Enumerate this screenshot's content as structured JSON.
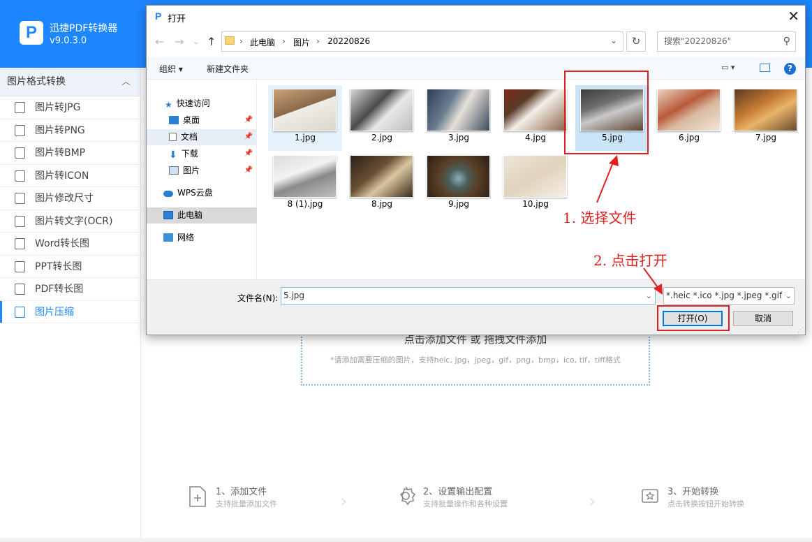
{
  "app": {
    "name": "迅捷PDF转换器",
    "version": "v9.0.3.0",
    "logo_letter": "P"
  },
  "sidebar": {
    "title": "图片格式转换",
    "items": [
      {
        "label": "图片转JPG",
        "active": false
      },
      {
        "label": "图片转PNG",
        "active": false
      },
      {
        "label": "图片转BMP",
        "active": false
      },
      {
        "label": "图片转ICON",
        "active": false
      },
      {
        "label": "图片修改尺寸",
        "active": false
      },
      {
        "label": "图片转文字(OCR)",
        "active": false
      },
      {
        "label": "Word转长图",
        "active": false
      },
      {
        "label": "PPT转长图",
        "active": false
      },
      {
        "label": "PDF转长图",
        "active": false
      },
      {
        "label": "图片压缩",
        "active": true
      }
    ]
  },
  "main": {
    "drop_text": "点击添加文件 或 拖拽文件添加",
    "drop_hint": "*请添加需要压缩的图片，支持heic, jpg，jpeg，gif，png，bmp，ico, tif，tiff格式",
    "steps": [
      {
        "title": "1、添加文件",
        "sub": "支持批量添加文件",
        "icon": "add-file-icon"
      },
      {
        "title": "2、设置输出配置",
        "sub": "支持批量操作和各种设置",
        "icon": "gear-icon"
      },
      {
        "title": "3、开始转换",
        "sub": "点击转换按钮开始转换",
        "icon": "convert-icon"
      }
    ]
  },
  "dialog": {
    "title": "打开",
    "address": [
      "此电脑",
      "图片",
      "20220826"
    ],
    "search_placeholder": "搜索\"20220826\"",
    "toolbar": {
      "organize": "组织 ▾",
      "new_folder": "新建文件夹"
    },
    "nav": [
      {
        "label": "快速访问",
        "icon": "star-icon"
      },
      {
        "label": "桌面",
        "icon": "desktop-icon",
        "pinned": true
      },
      {
        "label": "文档",
        "icon": "document-icon",
        "pinned": true
      },
      {
        "label": "下载",
        "icon": "download-icon",
        "pinned": true
      },
      {
        "label": "图片",
        "icon": "picture-icon",
        "pinned": true
      },
      {
        "label": "WPS云盘",
        "icon": "cloud-icon"
      },
      {
        "label": "此电脑",
        "icon": "computer-icon",
        "selected": true
      },
      {
        "label": "网络",
        "icon": "network-icon"
      }
    ],
    "files": [
      "1.jpg",
      "2.jpg",
      "3.jpg",
      "4.jpg",
      "5.jpg",
      "6.jpg",
      "7.jpg",
      "8 (1).jpg",
      "8.jpg",
      "9.jpg",
      "10.jpg"
    ],
    "selected_file": "5.jpg",
    "filename_label": "文件名(N):",
    "filename_value": "5.jpg",
    "filter_value": "*.heic *.ico *.jpg *.jpeg *.gif *",
    "open_button": "打开(O)",
    "cancel_button": "取消"
  },
  "annotations": {
    "step1": "1. 选择文件",
    "step2": "2. 点击打开",
    "color": "#e02020"
  },
  "colors": {
    "accent": "#1e86ff"
  }
}
